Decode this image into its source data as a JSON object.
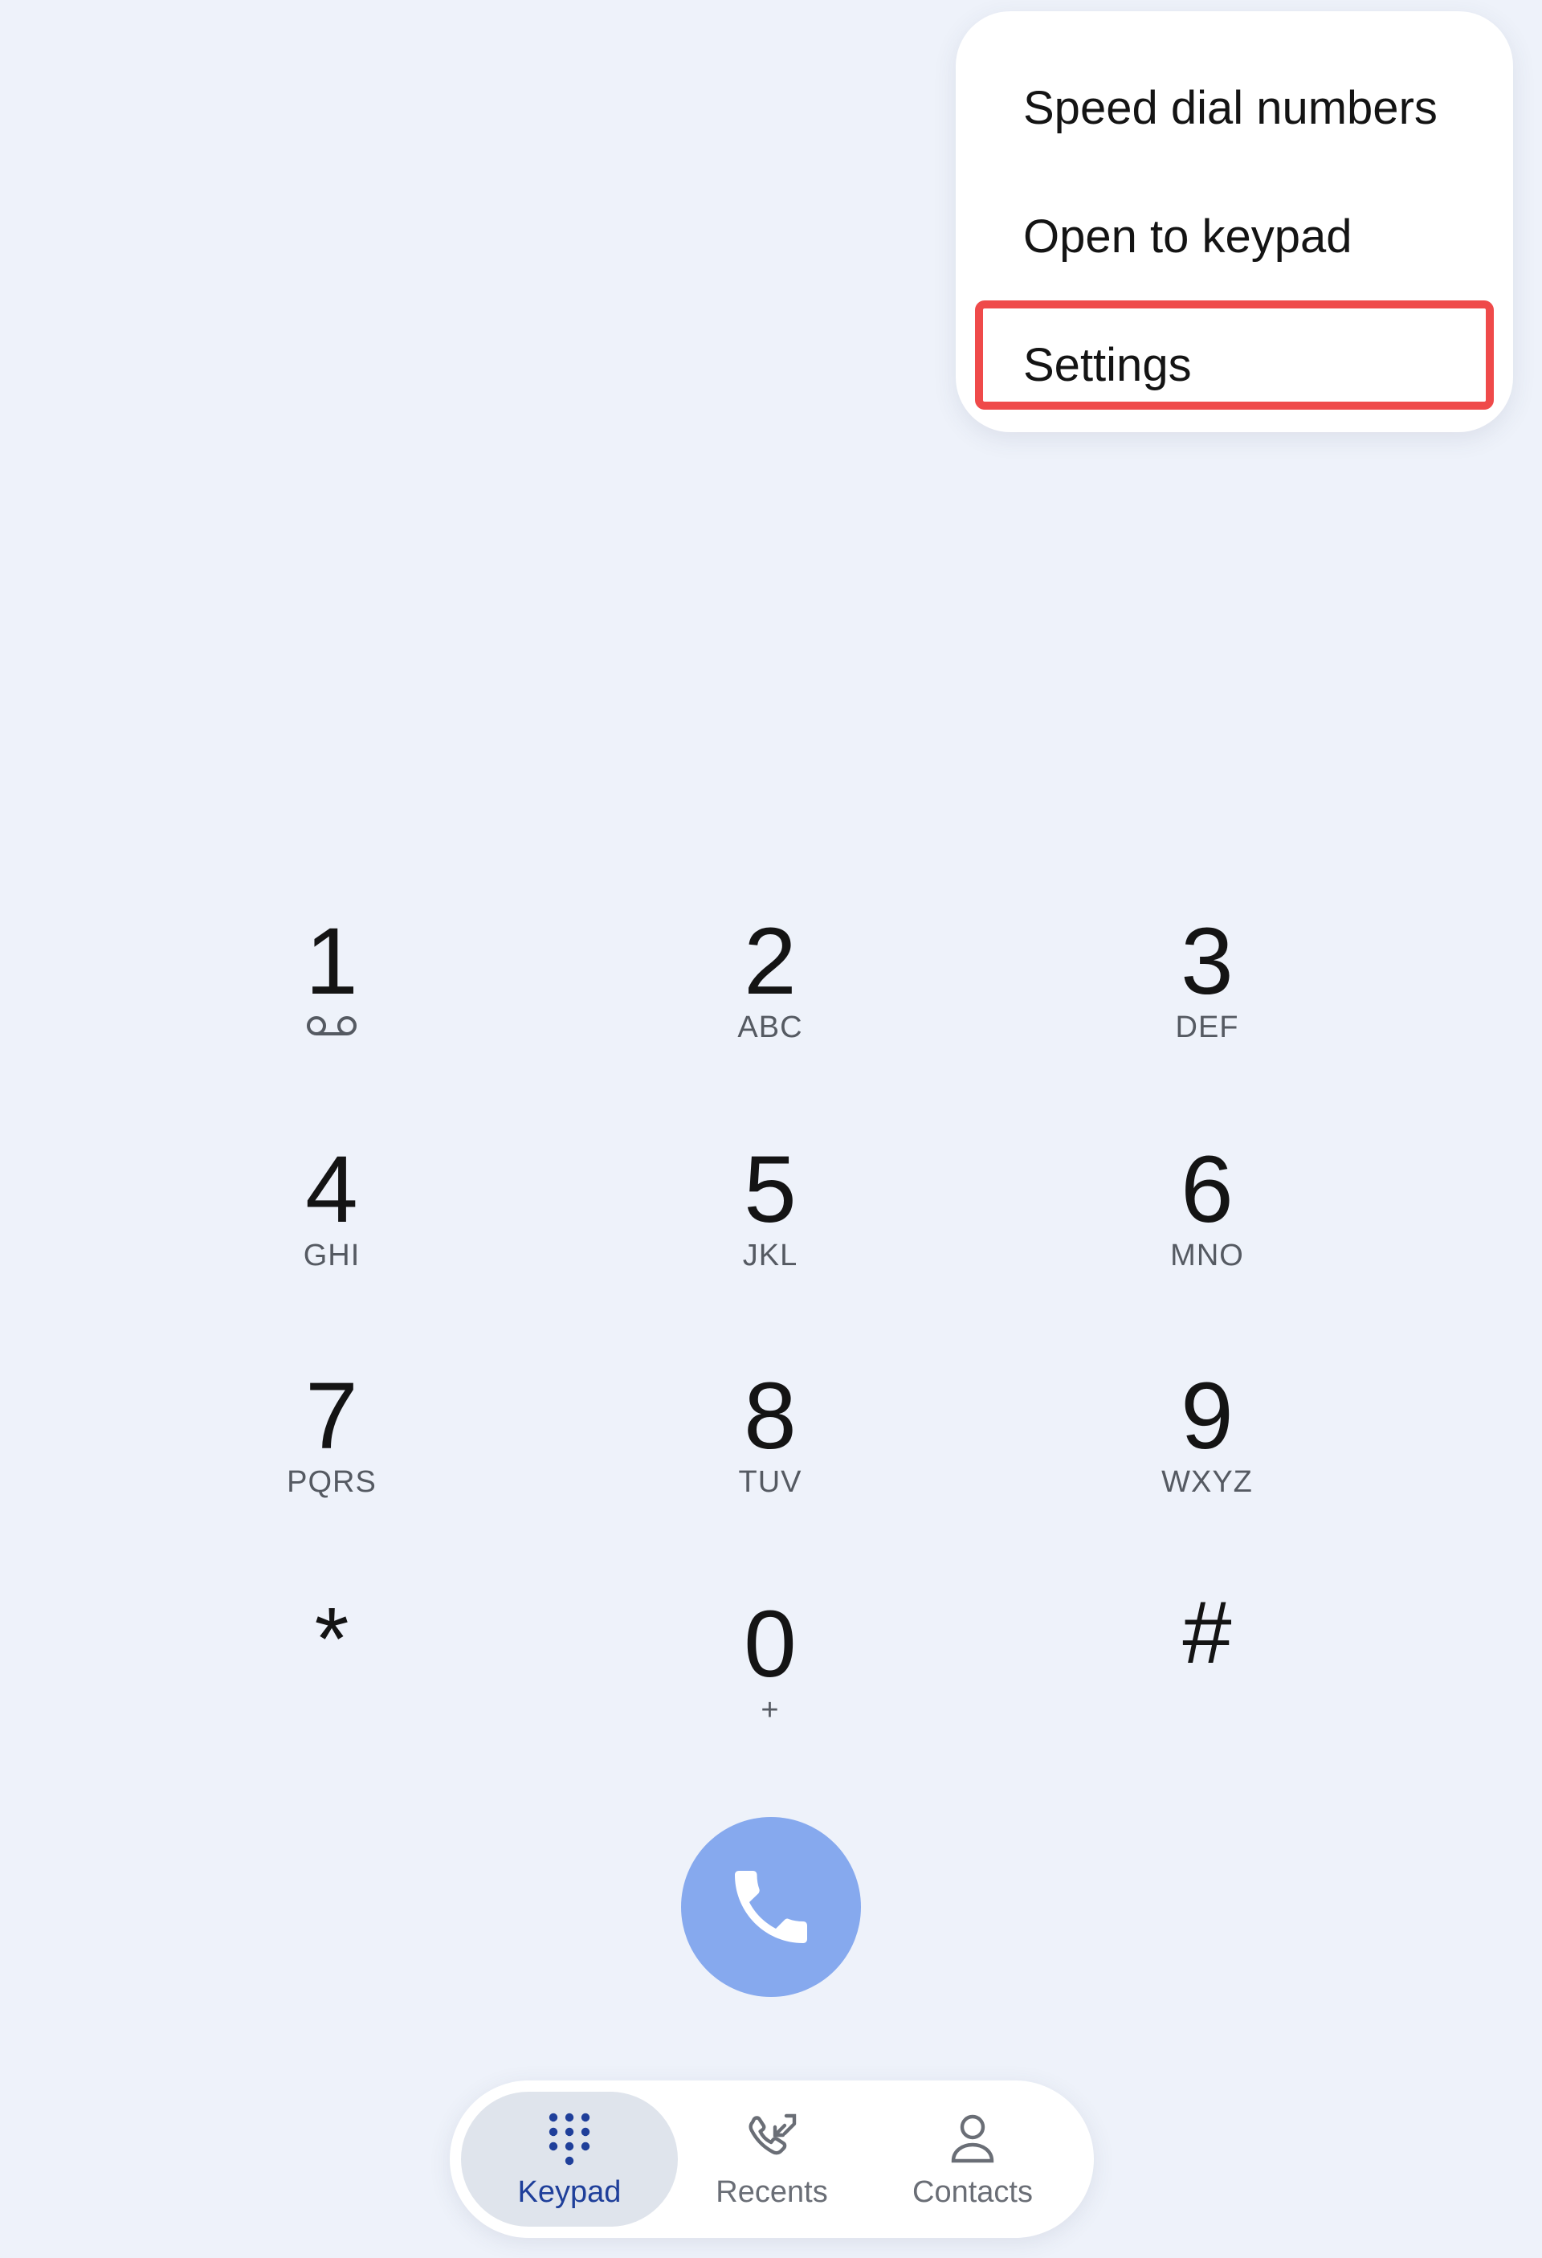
{
  "menu": {
    "items": [
      {
        "label": "Speed dial numbers"
      },
      {
        "label": "Open to keypad"
      },
      {
        "label": "Settings"
      }
    ],
    "highlighted_item": "Settings",
    "highlight_color": "#ef4a4a"
  },
  "keypad": {
    "keys": [
      {
        "digit": "1",
        "letters": "",
        "icon": "voicemail-icon"
      },
      {
        "digit": "2",
        "letters": "ABC"
      },
      {
        "digit": "3",
        "letters": "DEF"
      },
      {
        "digit": "4",
        "letters": "GHI"
      },
      {
        "digit": "5",
        "letters": "JKL"
      },
      {
        "digit": "6",
        "letters": "MNO"
      },
      {
        "digit": "7",
        "letters": "PQRS"
      },
      {
        "digit": "8",
        "letters": "TUV"
      },
      {
        "digit": "9",
        "letters": "WXYZ"
      },
      {
        "digit": "*",
        "letters": ""
      },
      {
        "digit": "0",
        "letters": "+"
      },
      {
        "digit": "#",
        "letters": ""
      }
    ]
  },
  "call_button": {
    "icon": "phone-icon",
    "color": "#86a9ee"
  },
  "bottom_nav": {
    "items": [
      {
        "label": "Keypad",
        "icon": "dialpad-icon",
        "active": true
      },
      {
        "label": "Recents",
        "icon": "recent-calls-icon",
        "active": false
      },
      {
        "label": "Contacts",
        "icon": "person-icon",
        "active": false
      }
    ],
    "active_color": "#1f3f9a"
  }
}
